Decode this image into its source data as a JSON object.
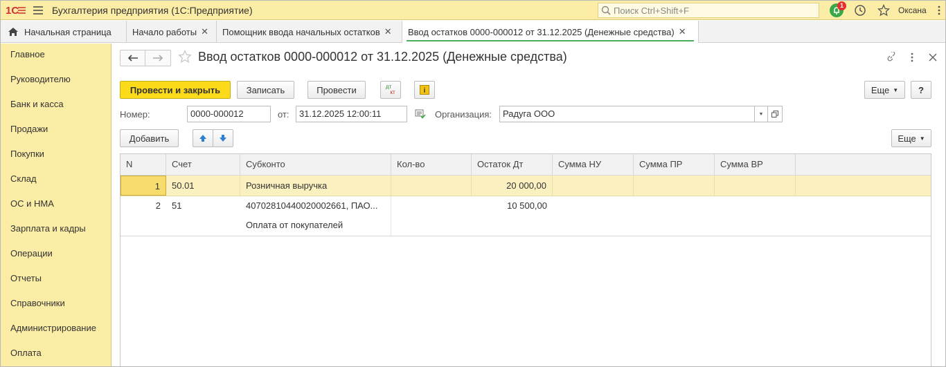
{
  "topbar": {
    "app_title": "Бухгалтерия предприятия  (1С:Предприятие)",
    "search_placeholder": "Поиск Ctrl+Shift+F",
    "notification_count": "1",
    "user_name": "Оксана"
  },
  "tabs": [
    {
      "label": "Начальная страница"
    },
    {
      "label": "Начало работы"
    },
    {
      "label": "Помощник ввода начальных остатков"
    },
    {
      "label": "Ввод остатков 0000-000012 от 31.12.2025 (Денежные средства)"
    }
  ],
  "sidebar": {
    "items": [
      {
        "label": "Главное"
      },
      {
        "label": "Руководителю"
      },
      {
        "label": "Банк и касса"
      },
      {
        "label": "Продажи"
      },
      {
        "label": "Покупки"
      },
      {
        "label": "Склад"
      },
      {
        "label": "ОС и НМА"
      },
      {
        "label": "Зарплата и кадры"
      },
      {
        "label": "Операции"
      },
      {
        "label": "Отчеты"
      },
      {
        "label": "Справочники"
      },
      {
        "label": "Администрирование"
      },
      {
        "label": "Оплата"
      }
    ]
  },
  "document": {
    "title": "Ввод остатков 0000-000012 от 31.12.2025 (Денежные средства)"
  },
  "toolbar": {
    "post_close": "Провести и закрыть",
    "save": "Записать",
    "post": "Провести",
    "dt_label": "дт",
    "kt_label": "кт",
    "more": "Еще",
    "help": "?"
  },
  "form": {
    "number_label": "Номер:",
    "number_value": "0000-000012",
    "date_label": "от:",
    "date_value": "31.12.2025 12:00:11",
    "org_label": "Организация:",
    "org_value": "Радуга ООО"
  },
  "table_toolbar": {
    "add": "Добавить",
    "more": "Еще"
  },
  "table": {
    "columns": [
      "N",
      "Счет",
      "Субконто",
      "Кол-во",
      "Остаток Дт",
      "Сумма НУ",
      "Сумма ПР",
      "Сумма ВР"
    ],
    "rows": [
      {
        "n": "1",
        "account": "50.01",
        "subconto": [
          "Розничная выручка"
        ],
        "qty": "",
        "balance": "20 000,00",
        "nu": "",
        "pr": "",
        "vr": ""
      },
      {
        "n": "2",
        "account": "51",
        "subconto": [
          "40702810440020002661, ПАО...",
          "Оплата от покупателей"
        ],
        "qty": "",
        "balance": "10 500,00",
        "nu": "",
        "pr": "",
        "vr": ""
      }
    ]
  },
  "colors": {
    "accent_yellow": "#fcdb1b",
    "panel_yellow": "#fbeda6",
    "active_tab_underline": "#4bae5c",
    "notification_green": "#3aa84a",
    "badge_red": "#e4312b"
  }
}
